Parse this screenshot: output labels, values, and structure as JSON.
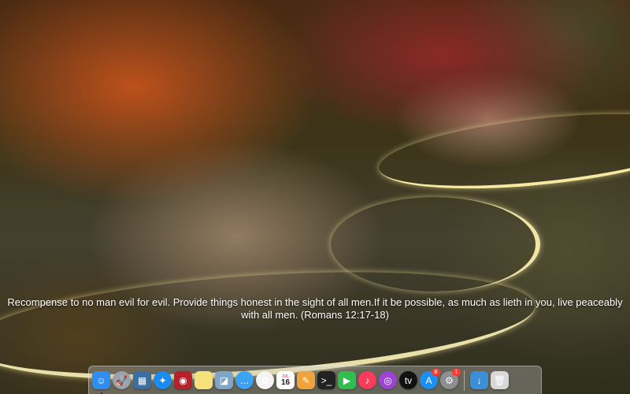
{
  "wallpaper": {
    "quote": "Recompense to no man evil for evil. Provide things honest in the sight of all men.If it be possible, as much as lieth in you, live peaceably with all men. (Romans 12:17-18)"
  },
  "dock": {
    "apps": [
      {
        "name": "finder-icon",
        "glyph": "☺",
        "color": "#2f8ef0",
        "running": true
      },
      {
        "name": "launchpad-icon",
        "glyph": "🚀",
        "color": "#9aa3ad",
        "round": true
      },
      {
        "name": "mission-control-icon",
        "glyph": "▦",
        "color": "#3a6ea5"
      },
      {
        "name": "safari-icon",
        "glyph": "✦",
        "color": "#1a8cf0",
        "round": true
      },
      {
        "name": "photo-booth-icon",
        "glyph": "◉",
        "color": "#b8202a"
      },
      {
        "name": "notes-icon",
        "glyph": "",
        "color": "#f6e27a"
      },
      {
        "name": "preview-icon",
        "glyph": "◪",
        "color": "#7fa6c8"
      },
      {
        "name": "messages-icon",
        "glyph": "…",
        "color": "#3aa3f5",
        "round": true
      },
      {
        "name": "photos-icon",
        "glyph": "✿",
        "color": "#f4f4f4",
        "round": true
      },
      {
        "name": "calendar-icon",
        "calendar_month": "JUL",
        "calendar_day": "16",
        "color": "#ffffff"
      },
      {
        "name": "pages-icon",
        "glyph": "✎",
        "color": "#f2a23a"
      },
      {
        "name": "terminal-icon",
        "glyph": ">_",
        "color": "#222222"
      },
      {
        "name": "facetime-icon",
        "glyph": "▶",
        "color": "#2fbf4f"
      },
      {
        "name": "music-icon",
        "glyph": "♪",
        "color": "#fa3c5a",
        "round": true
      },
      {
        "name": "podcasts-icon",
        "glyph": "◎",
        "color": "#9b44d6",
        "round": true
      },
      {
        "name": "apple-tv-icon",
        "glyph": "tv",
        "color": "#111111",
        "round": true
      },
      {
        "name": "app-store-icon",
        "glyph": "A",
        "color": "#1d8ff2",
        "round": true,
        "badge": "8"
      },
      {
        "name": "system-preferences-icon",
        "glyph": "⚙",
        "color": "#8e8e93",
        "round": true,
        "badge": "1"
      }
    ],
    "right_items": [
      {
        "name": "downloads-folder-icon",
        "glyph": "↓",
        "color": "#3b8ed8"
      },
      {
        "name": "trash-icon",
        "glyph": "🗑",
        "color": "#d8d8d8"
      }
    ]
  }
}
